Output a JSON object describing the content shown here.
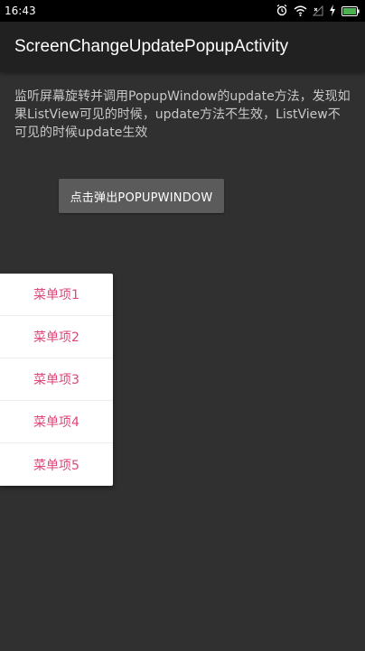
{
  "status_bar": {
    "time": "16:43",
    "icons": [
      "alarm-icon",
      "wifi-icon",
      "signal-x-icon",
      "charging-icon",
      "battery-icon"
    ]
  },
  "app_bar": {
    "title": "ScreenChangeUpdatePopupActivity"
  },
  "main": {
    "description": "监听屏幕旋转并调用PopupWindow的update方法，发现如果ListView可见的时候，update方法不生效，ListView不可见的时候update生效",
    "button_label": "点击弹出POPUPWINDOW"
  },
  "popup_menu": {
    "items": [
      "菜单项1",
      "菜单项2",
      "菜单项3",
      "菜单项4",
      "菜单项5"
    ],
    "text_color": "#e0457b"
  },
  "colors": {
    "background": "#303030",
    "app_bar": "#212121",
    "status_bar": "#000000",
    "button": "#5b5b5b",
    "battery": "#4caf50"
  }
}
